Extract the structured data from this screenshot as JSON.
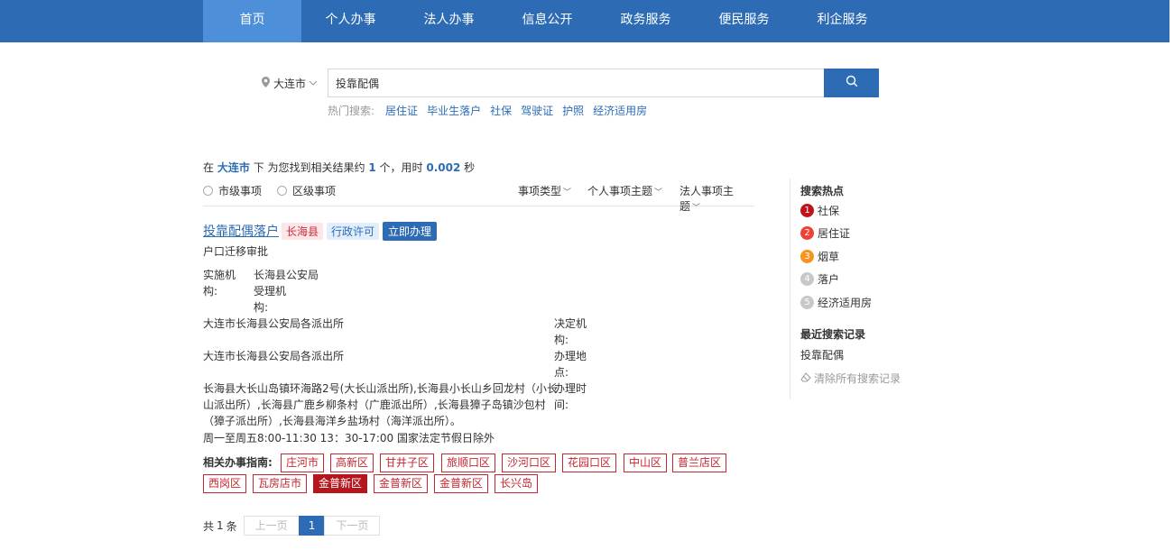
{
  "nav": {
    "items": [
      {
        "label": "首页",
        "active": true
      },
      {
        "label": "个人办事"
      },
      {
        "label": "法人办事"
      },
      {
        "label": "信息公开"
      },
      {
        "label": "政务服务"
      },
      {
        "label": "便民服务"
      },
      {
        "label": "利企服务"
      }
    ]
  },
  "search": {
    "city": "大连市",
    "value": "投靠配偶",
    "hot_label": "热门搜索:",
    "hot": [
      "居住证",
      "毕业生落户",
      "社保",
      "驾驶证",
      "护照",
      "经济适用房"
    ]
  },
  "summary": {
    "pre": "在",
    "city": "大连市",
    "mid": "下 为您找到相关结果约",
    "count": "1",
    "mid2": "个，用时",
    "time": "0.002",
    "post": "秒"
  },
  "filters": {
    "radio_city": "市级事项",
    "radio_district": "区级事项",
    "type": "事项类型",
    "personal": "个人事项主题",
    "legal": "法人事项主题"
  },
  "result": {
    "title": "投靠配偶落户",
    "tag_area": "长海县",
    "tag_type": "行政许可",
    "button": "立即办理",
    "subtitle": "户口迁移审批",
    "impl_label_1": "实施机",
    "impl_label_2": "构:",
    "impl_value": "长海县公安局",
    "accept_label_1": "受理机",
    "accept_label_2": "构:",
    "accept_value": "大连市长海县公安局各派出所",
    "decide_label_1": "决定机",
    "decide_label_2": "构:",
    "decide_value": "大连市长海县公安局各派出所",
    "place_label_1": "办理地",
    "place_label_2": "点:",
    "place_lines": [
      "长海县大长山岛镇环海路2号(大长山派出所),长海县小长山乡回龙村（小长",
      "山派出所）,长海县广鹿乡柳条村（广鹿派出所）,长海县獐子岛镇沙包村",
      "（獐子派出所）,长海县海洋乡盐场村（海洋派出所）。"
    ],
    "time_label_1": "办理时",
    "time_label_2": "间:",
    "time_value": "周一至周五8:00-11:30 13：30-17:00 国家法定节假日除外",
    "guide_label": "相关办事指南:",
    "areas_row1": [
      "庄河市",
      "高新区",
      "甘井子区",
      "旅顺口区",
      "沙河口区",
      "花园口区",
      "中山区",
      "普兰店区"
    ],
    "areas_row2": [
      "西岗区",
      "瓦房店市",
      "金普新区",
      "金普新区",
      "金普新区",
      "长兴岛"
    ]
  },
  "pager": {
    "total_pre": "共",
    "total": "1",
    "total_post": "条",
    "prev": "上一页",
    "current": "1",
    "next": "下一页"
  },
  "sidebar": {
    "hot_title": "搜索热点",
    "hot_items": [
      {
        "rank": "1",
        "label": "社保",
        "color": "#c0141c"
      },
      {
        "rank": "2",
        "label": "居住证",
        "color": "#ee4236"
      },
      {
        "rank": "3",
        "label": "烟草",
        "color": "#f7941d"
      },
      {
        "rank": "4",
        "label": "落户",
        "color": "#c8c8c8"
      },
      {
        "rank": "5",
        "label": "经济适用房",
        "color": "#c8c8c8"
      }
    ],
    "recent_title": "最近搜索记录",
    "recent_item": "投靠配偶",
    "clear": "清除所有搜索记录"
  },
  "colors": {
    "brand": "#2d6cb5",
    "active_nav": "#4d8fd8",
    "area_red": "#c5262f"
  }
}
